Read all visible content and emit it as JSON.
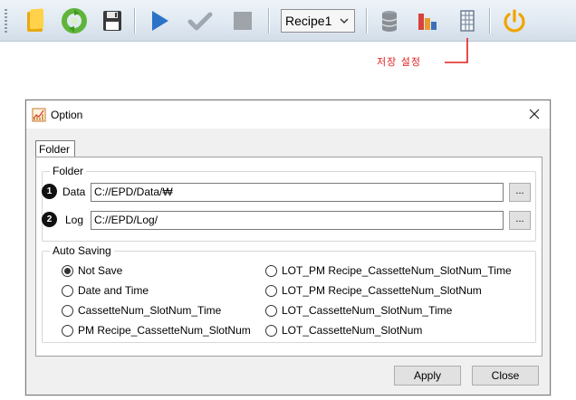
{
  "toolbar": {
    "buttons": [
      {
        "name": "open-folder-icon",
        "color": "#f1b817"
      },
      {
        "name": "refresh-icon",
        "color": "#5fb53a"
      },
      {
        "name": "save-icon",
        "color": "#3a3a3a"
      },
      {
        "name": "play-icon",
        "color": "#2b73c6"
      },
      {
        "name": "check-icon",
        "color": "#9fa8b2"
      },
      {
        "name": "stop-icon",
        "color": "#9fa4aa"
      },
      {
        "name": "database-icon",
        "color": "#8a8f96"
      },
      {
        "name": "bar-chart-icon",
        "color": "#d8423a"
      },
      {
        "name": "spreadsheet-settings-icon",
        "color": "#6d7f95"
      },
      {
        "name": "power-icon",
        "color": "#f0a400"
      }
    ],
    "recipe_select": {
      "value": "Recipe1"
    }
  },
  "annotation": {
    "text": "저장 설정",
    "color": "#e02020"
  },
  "dialog": {
    "title": "Option",
    "tab_label": "Folder",
    "folder_group": {
      "title": "Folder",
      "rows": [
        {
          "badge": "1",
          "label": "Data",
          "value": "C://EPD/Data/₩",
          "browse_label": "..."
        },
        {
          "badge": "2",
          "label": "Log",
          "value": "C://EPD/Log/",
          "browse_label": "..."
        }
      ]
    },
    "auto_saving": {
      "title": "Auto Saving",
      "left_options": [
        {
          "label": "Not Save",
          "selected": true
        },
        {
          "label": "Date and Time",
          "selected": false
        },
        {
          "label": "CassetteNum_SlotNum_Time",
          "selected": false
        },
        {
          "label": "PM Recipe_CassetteNum_SlotNum",
          "selected": false
        }
      ],
      "right_options": [
        {
          "label": "LOT_PM Recipe_CassetteNum_SlotNum_Time",
          "selected": false
        },
        {
          "label": "LOT_PM Recipe_CassetteNum_SlotNum",
          "selected": false
        },
        {
          "label": "LOT_CassetteNum_SlotNum_Time",
          "selected": false
        },
        {
          "label": "LOT_CassetteNum_SlotNum",
          "selected": false
        }
      ]
    },
    "apply_label": "Apply",
    "close_label": "Close"
  }
}
